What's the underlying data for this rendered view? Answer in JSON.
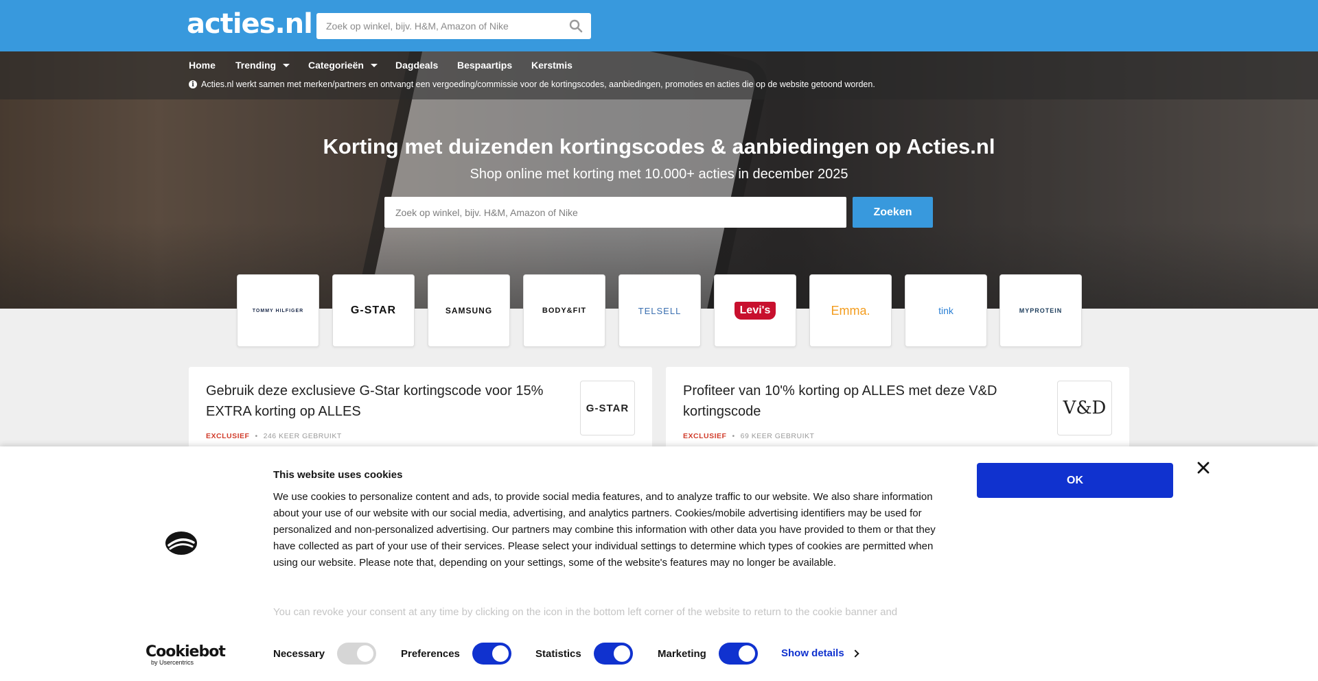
{
  "header": {
    "logo_text": "acties.nl",
    "search_placeholder": "Zoek op winkel, bijv. H&M, Amazon of Nike"
  },
  "nav": {
    "items": [
      {
        "label": "Home",
        "dropdown": false
      },
      {
        "label": "Trending",
        "dropdown": true
      },
      {
        "label": "Categorieën",
        "dropdown": true
      },
      {
        "label": "Dagdeals",
        "dropdown": false
      },
      {
        "label": "Bespaartips",
        "dropdown": false
      },
      {
        "label": "Kerstmis",
        "dropdown": false
      }
    ],
    "disclosure": "Acties.nl werkt samen met merken/partners en ontvangt een vergoeding/commissie voor de kortingscodes, aanbiedingen, promoties en acties die op de website getoond worden."
  },
  "hero": {
    "title": "Korting met duizenden kortingscodes & aanbiedingen op Acties.nl",
    "subtitle": "Shop online met korting met 10.000+ acties in december 2025",
    "search_placeholder": "Zoek op winkel, bijv. H&M, Amazon of Nike",
    "button_label": "Zoeken"
  },
  "brands": [
    {
      "name": "TOMMY HILFIGER",
      "color": "#1b2a4a"
    },
    {
      "name": "G-STAR",
      "color": "#111111"
    },
    {
      "name": "SAMSUNG",
      "color": "#111111"
    },
    {
      "name": "BODY&FIT",
      "color": "#111111"
    },
    {
      "name": "TELSELL",
      "color": "#3a6fb0"
    },
    {
      "name": "Levi's",
      "color": "#c8102e"
    },
    {
      "name": "Emma.",
      "color": "#f39c1e"
    },
    {
      "name": "tink",
      "color": "#2a7fd4"
    },
    {
      "name": "MYPROTEIN",
      "color": "#1b3b5a"
    }
  ],
  "deals": [
    {
      "title": "Gebruik deze exclusieve G-Star kortingscode voor 15% EXTRA korting op ALLES",
      "tag": "EXCLUSIEF",
      "usage": "246 KEER GEBRUIKT",
      "logo": "G-STAR"
    },
    {
      "title": "Profiteer van 10'% korting op ALLES met deze V&D kortingscode",
      "tag": "EXCLUSIEF",
      "usage": "69 KEER GEBRUIKT",
      "logo": "V&D"
    }
  ],
  "cookie": {
    "title": "This website uses cookies",
    "body": "We use cookies to personalize content and ads, to provide social media features, and to analyze traffic to our website. We also share information about your use of our website with our social media, advertising, and analytics partners. Cookies/mobile advertising identifiers may be used for personalized and non-personalized advertising. Our partners may combine this information with other data you have provided to them or that they have collected as part of your use of their services. Please select your individual settings to determine which types of cookies are permitted when using our website. Please note that, depending on your settings, some of the website's features may no longer be available.",
    "body_faded": "You can revoke your consent at any time by clicking on the icon in the bottom left corner of the website to return to the cookie banner and",
    "ok_label": "OK",
    "brand_name": "Cookiebot",
    "brand_by": "by Usercentrics",
    "toggles": [
      {
        "label": "Necessary",
        "state": "disabled-on"
      },
      {
        "label": "Preferences",
        "state": "on"
      },
      {
        "label": "Statistics",
        "state": "on"
      },
      {
        "label": "Marketing",
        "state": "on"
      }
    ],
    "show_details": "Show details"
  },
  "colors": {
    "brand_blue": "#3899dd",
    "cookie_blue": "#1032cf",
    "exclusive_red": "#d13c2b"
  }
}
